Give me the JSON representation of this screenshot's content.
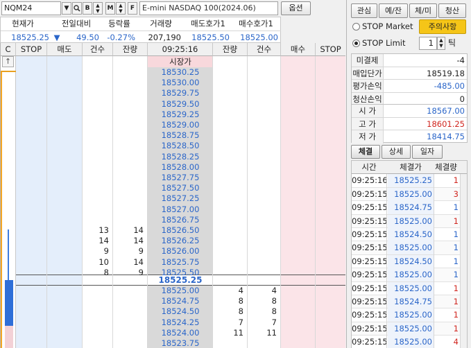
{
  "toolbar": {
    "symbol": "NQM24",
    "buttons": [
      "B",
      "M",
      "F"
    ],
    "product_name": "E-mini NASDAQ 100(2024.06)",
    "options_label": "옵션"
  },
  "info": {
    "headers": [
      "현재가",
      "전일대비",
      "등락률",
      "거래량",
      "매도호가1",
      "매수호가1"
    ],
    "values": {
      "current": "18525.25",
      "change_arrow": "▼",
      "change": "49.50",
      "rate": "-0.27%",
      "volume": "207,190",
      "ask1": "18525.50",
      "bid1": "18525.00"
    }
  },
  "grid": {
    "headers": [
      "C",
      "STOP",
      "매도",
      "건수",
      "잔량",
      "09:25:16",
      "잔량",
      "건수",
      "매수",
      "STOP"
    ],
    "scroll_up": "↑",
    "market_row": "시장가",
    "current_price": "18525.25",
    "sell_rows": [
      {
        "price": "18530.25",
        "count": "",
        "qty": ""
      },
      {
        "price": "18530.00",
        "count": "",
        "qty": ""
      },
      {
        "price": "18529.75",
        "count": "",
        "qty": ""
      },
      {
        "price": "18529.50",
        "count": "",
        "qty": ""
      },
      {
        "price": "18529.25",
        "count": "",
        "qty": ""
      },
      {
        "price": "18529.00",
        "count": "",
        "qty": ""
      },
      {
        "price": "18528.75",
        "count": "",
        "qty": ""
      },
      {
        "price": "18528.50",
        "count": "",
        "qty": ""
      },
      {
        "price": "18528.25",
        "count": "",
        "qty": ""
      },
      {
        "price": "18528.00",
        "count": "",
        "qty": ""
      },
      {
        "price": "18527.75",
        "count": "",
        "qty": ""
      },
      {
        "price": "18527.50",
        "count": "",
        "qty": ""
      },
      {
        "price": "18527.25",
        "count": "",
        "qty": ""
      },
      {
        "price": "18527.00",
        "count": "",
        "qty": ""
      },
      {
        "price": "18526.75",
        "count": "",
        "qty": ""
      },
      {
        "price": "18526.50",
        "count": "13",
        "qty": "14"
      },
      {
        "price": "18526.25",
        "count": "14",
        "qty": "14"
      },
      {
        "price": "18526.00",
        "count": "9",
        "qty": "9"
      },
      {
        "price": "18525.75",
        "count": "10",
        "qty": "14"
      },
      {
        "price": "18525.50",
        "count": "8",
        "qty": "9"
      }
    ],
    "buy_rows": [
      {
        "price": "18525.00",
        "qty": "4",
        "count": "4"
      },
      {
        "price": "18524.75",
        "qty": "8",
        "count": "8"
      },
      {
        "price": "18524.50",
        "qty": "8",
        "count": "8"
      },
      {
        "price": "18524.25",
        "qty": "7",
        "count": "7"
      },
      {
        "price": "18524.00",
        "qty": "11",
        "count": "11"
      },
      {
        "price": "18523.75",
        "qty": "",
        "count": ""
      }
    ]
  },
  "right_panel": {
    "top_buttons": [
      "관심",
      "예/잔",
      "체/미",
      "청산"
    ],
    "stop_market": "STOP Market",
    "stop_limit": "STOP Limit",
    "notice_label": "주의사항",
    "tick_value": "1",
    "tick_label": "틱",
    "position": [
      {
        "label": "미결제",
        "value": "-4",
        "color": "#222222"
      },
      {
        "label": "매입단가",
        "value": "18519.18",
        "color": "#222222"
      },
      {
        "label": "평가손익",
        "value": "-485.00",
        "color": "#2b66c9"
      },
      {
        "label": "청산손익",
        "value": "0",
        "color": "#222222"
      }
    ],
    "ohl": [
      {
        "label": "시 가",
        "value": "18567.00",
        "color": "#2b66c9"
      },
      {
        "label": "고 가",
        "value": "18601.25",
        "color": "#d0251e"
      },
      {
        "label": "저 가",
        "value": "18414.75",
        "color": "#2b66c9"
      }
    ],
    "tabs": [
      "체결",
      "상세",
      "일자"
    ],
    "trade_headers": [
      "시간",
      "체결가",
      "체결량"
    ],
    "trades": [
      {
        "time": "09:25:16",
        "price": "18525.25",
        "qty": "1",
        "color": "#d0251e"
      },
      {
        "time": "09:25:15",
        "price": "18525.00",
        "qty": "3",
        "color": "#d0251e"
      },
      {
        "time": "09:25:15",
        "price": "18524.75",
        "qty": "1",
        "color": "#2b66c9"
      },
      {
        "time": "09:25:15",
        "price": "18525.00",
        "qty": "1",
        "color": "#d0251e"
      },
      {
        "time": "09:25:15",
        "price": "18524.50",
        "qty": "1",
        "color": "#2b66c9"
      },
      {
        "time": "09:25:15",
        "price": "18525.00",
        "qty": "1",
        "color": "#2b66c9"
      },
      {
        "time": "09:25:15",
        "price": "18524.50",
        "qty": "1",
        "color": "#2b66c9"
      },
      {
        "time": "09:25:15",
        "price": "18525.00",
        "qty": "1",
        "color": "#2b66c9"
      },
      {
        "time": "09:25:15",
        "price": "18525.00",
        "qty": "1",
        "color": "#d0251e"
      },
      {
        "time": "09:25:15",
        "price": "18524.75",
        "qty": "1",
        "color": "#d0251e"
      },
      {
        "time": "09:25:15",
        "price": "18525.00",
        "qty": "1",
        "color": "#d0251e"
      },
      {
        "time": "09:25:15",
        "price": "18525.00",
        "qty": "1",
        "color": "#d0251e"
      },
      {
        "time": "09:25:15",
        "price": "18525.00",
        "qty": "4",
        "color": "#d0251e"
      }
    ]
  },
  "colors": {
    "sell_bg": "#e4eefb",
    "buy_bg": "#fbe4e8",
    "price_col_bg": "#d9d9d9",
    "market_bg": "#f8d8dc",
    "blue": "#2b66c9",
    "red": "#d0251e",
    "notice_bg": "#f5c518"
  }
}
